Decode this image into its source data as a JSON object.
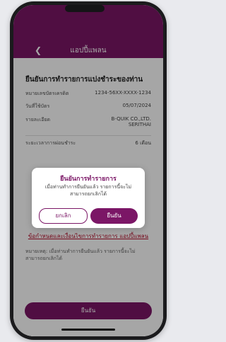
{
  "header": {
    "title": "แอปปี้แพลน",
    "back_icon": "chevron-left-icon"
  },
  "section": {
    "title": "ยืนยันการทำรายการแบ่งชำระของท่าน"
  },
  "rows": [
    {
      "label": "หมายเลขบัตรเครดิต",
      "value": "1234-56XX-XXXX-1234"
    },
    {
      "label": "วันที่ใช้บัตร",
      "value": "05/07/2024"
    },
    {
      "label": "รายละเอียด",
      "value": "B-QUIK CO.,LTD.",
      "value2": "SERITHAI"
    },
    {
      "label": "ระยะเวลาการผ่อนชำระ",
      "value": "6 เดือน"
    }
  ],
  "terms_link": "ข้อกำหนดและเงื่อนไขการทำรายการ แอปปี้แพลน",
  "note": "หมายเหตุ: เมื่อท่านทำการยืนยันแล้ว รายการนี้จะไม่สามารถยกเลิกได้",
  "bottom_button": "ยืนยัน",
  "dialog": {
    "title": "ยืนยันการทำรายการ",
    "message": "เมื่อท่านทำการยืนยันแล้ว รายการนี้จะไม่สามารถยกเลิกได้",
    "cancel": "ยกเลิก",
    "confirm": "ยืนยัน"
  },
  "colors": {
    "brand": "#7b1666",
    "link": "#b30b28"
  }
}
